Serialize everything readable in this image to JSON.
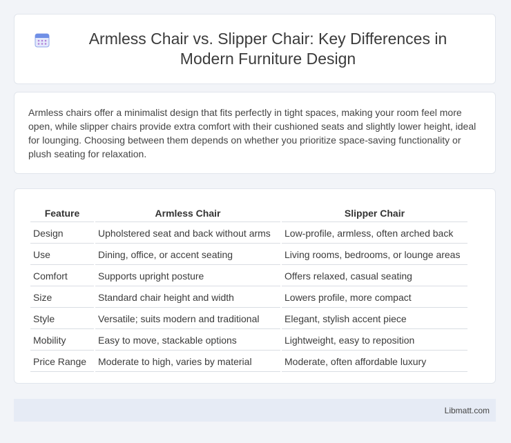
{
  "header": {
    "title": "Armless Chair vs. Slipper Chair: Key Differences in Modern Furniture Design",
    "icon": "calendar-icon",
    "icon_color": "#6c8be0"
  },
  "summary": {
    "text": "Armless chairs offer a minimalist design that fits perfectly in tight spaces, making your room feel more open, while slipper chairs provide extra comfort with their cushioned seats and slightly lower height, ideal for lounging. Choosing between them depends on whether you prioritize space-saving functionality or plush seating for relaxation."
  },
  "table": {
    "headers": [
      "Feature",
      "Armless Chair",
      "Slipper Chair"
    ],
    "rows": [
      [
        "Design",
        "Upholstered seat and back without arms",
        "Low-profile, armless, often arched back"
      ],
      [
        "Use",
        "Dining, office, or accent seating",
        "Living rooms, bedrooms, or lounge areas"
      ],
      [
        "Comfort",
        "Supports upright posture",
        "Offers relaxed, casual seating"
      ],
      [
        "Size",
        "Standard chair height and width",
        "Lowers profile, more compact"
      ],
      [
        "Style",
        "Versatile; suits modern and traditional",
        "Elegant, stylish accent piece"
      ],
      [
        "Mobility",
        "Easy to move, stackable options",
        "Lightweight, easy to reposition"
      ],
      [
        "Price Range",
        "Moderate to high, varies by material",
        "Moderate, often affordable luxury"
      ]
    ]
  },
  "footer": {
    "site": "Libmatt.com"
  }
}
